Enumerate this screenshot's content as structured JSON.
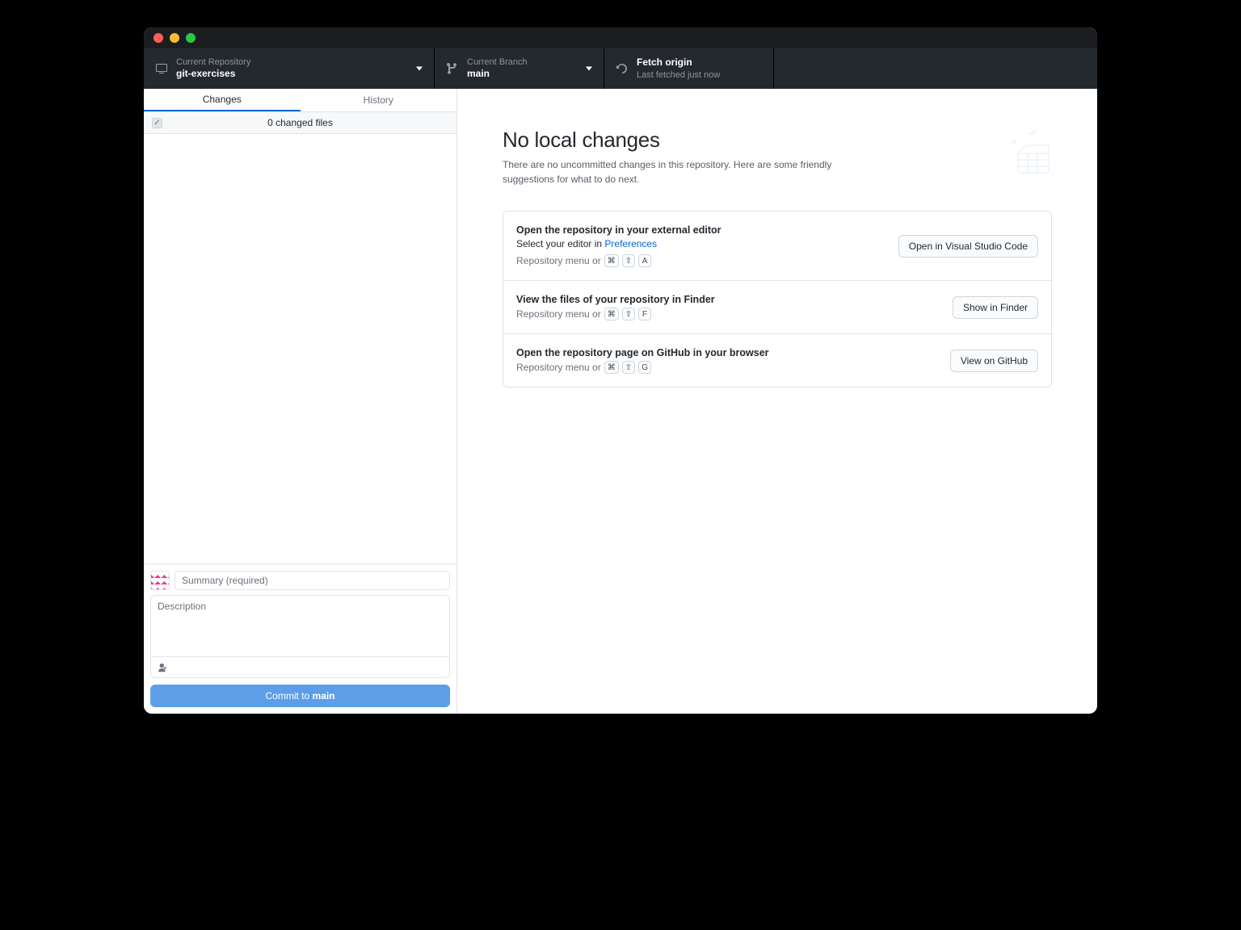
{
  "toolbar": {
    "repo_label": "Current Repository",
    "repo_name": "git-exercises",
    "branch_label": "Current Branch",
    "branch_name": "main",
    "fetch_title": "Fetch origin",
    "fetch_sub": "Last fetched just now"
  },
  "sidebar": {
    "tabs": {
      "changes": "Changes",
      "history": "History"
    },
    "changes_header": "0 changed files",
    "summary_placeholder": "Summary (required)",
    "description_placeholder": "Description",
    "commit_prefix": "Commit to ",
    "commit_branch": "main"
  },
  "main": {
    "title": "No local changes",
    "subtitle": "There are no uncommitted changes in this repository. Here are some friendly suggestions for what to do next.",
    "actions": [
      {
        "title": "Open the repository in your external editor",
        "sub_prefix": "Select your editor in ",
        "sub_link": "Preferences",
        "hint_prefix": "Repository menu or",
        "keys": [
          "⌘",
          "⇧",
          "A"
        ],
        "button": "Open in Visual Studio Code"
      },
      {
        "title": "View the files of your repository in Finder",
        "hint_prefix": "Repository menu or",
        "keys": [
          "⌘",
          "⇧",
          "F"
        ],
        "button": "Show in Finder"
      },
      {
        "title": "Open the repository page on GitHub in your browser",
        "hint_prefix": "Repository menu or",
        "keys": [
          "⌘",
          "⇧",
          "G"
        ],
        "button": "View on GitHub"
      }
    ]
  }
}
